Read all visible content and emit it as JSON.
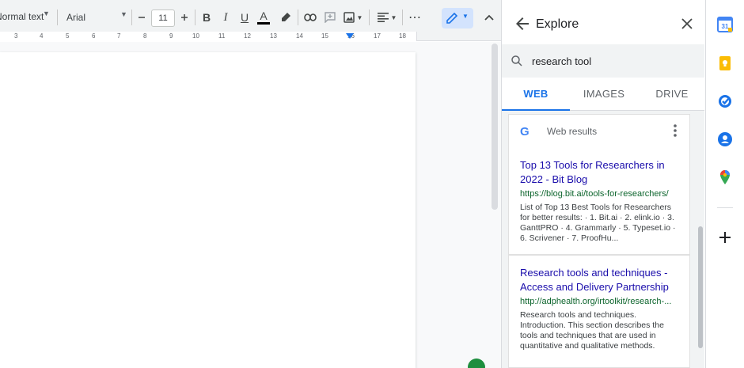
{
  "toolbar": {
    "style_label": "Normal text",
    "font_label": "Arial",
    "font_size": "11",
    "icons": [
      "minus-icon",
      "plus-icon",
      "bold-icon",
      "italic-icon",
      "underline-icon",
      "text-color-icon",
      "highlight-icon",
      "link-icon",
      "comment-icon",
      "image-icon",
      "align-icon",
      "more-icon",
      "pen-icon",
      "collapse-icon"
    ],
    "bold_glyph": "B",
    "italic_glyph": "I",
    "underline_glyph": "U",
    "text_color_glyph": "A",
    "more_glyph": "⋯",
    "text_color": "#000000"
  },
  "ruler": {
    "numbers": [
      "3",
      "4",
      "5",
      "6",
      "7",
      "8",
      "9",
      "10",
      "11",
      "12",
      "13",
      "14",
      "15",
      "16",
      "17",
      "18"
    ]
  },
  "explore": {
    "title": "Explore",
    "search_value": "research tool",
    "tabs": [
      {
        "label": "WEB",
        "active": true
      },
      {
        "label": "IMAGES",
        "active": false
      },
      {
        "label": "DRIVE",
        "active": false
      }
    ],
    "web_results_label": "Web results",
    "google_glyph": "G",
    "results": [
      {
        "title": "Top 13 Tools for Researchers in 2022 - Bit Blog",
        "url": "https://blog.bit.ai/tools-for-researchers/",
        "snippet": "List of Top 13 Best Tools for Researchers for better results: · 1. Bit.ai · 2. elink.io · 3. GanttPRO · 4. Grammarly · 5. Typeset.io · 6. Scrivener · 7. ProofHu..."
      },
      {
        "title": "Research tools and techniques - Access and Delivery Partnership",
        "url": "http://adphealth.org/irtoolkit/research-...",
        "snippet": "Research tools and techniques. Introduction. This section describes the tools and techniques that are used in quantitative and qualitative methods."
      }
    ]
  },
  "colors": {
    "accent": "#1a73e8",
    "link": "#1a0dab",
    "url": "#0d652d"
  },
  "rail": {
    "icons": [
      "calendar-icon",
      "keep-icon",
      "tasks-icon",
      "contacts-icon",
      "maps-icon",
      "add-icon"
    ],
    "calendar_day": "31"
  }
}
